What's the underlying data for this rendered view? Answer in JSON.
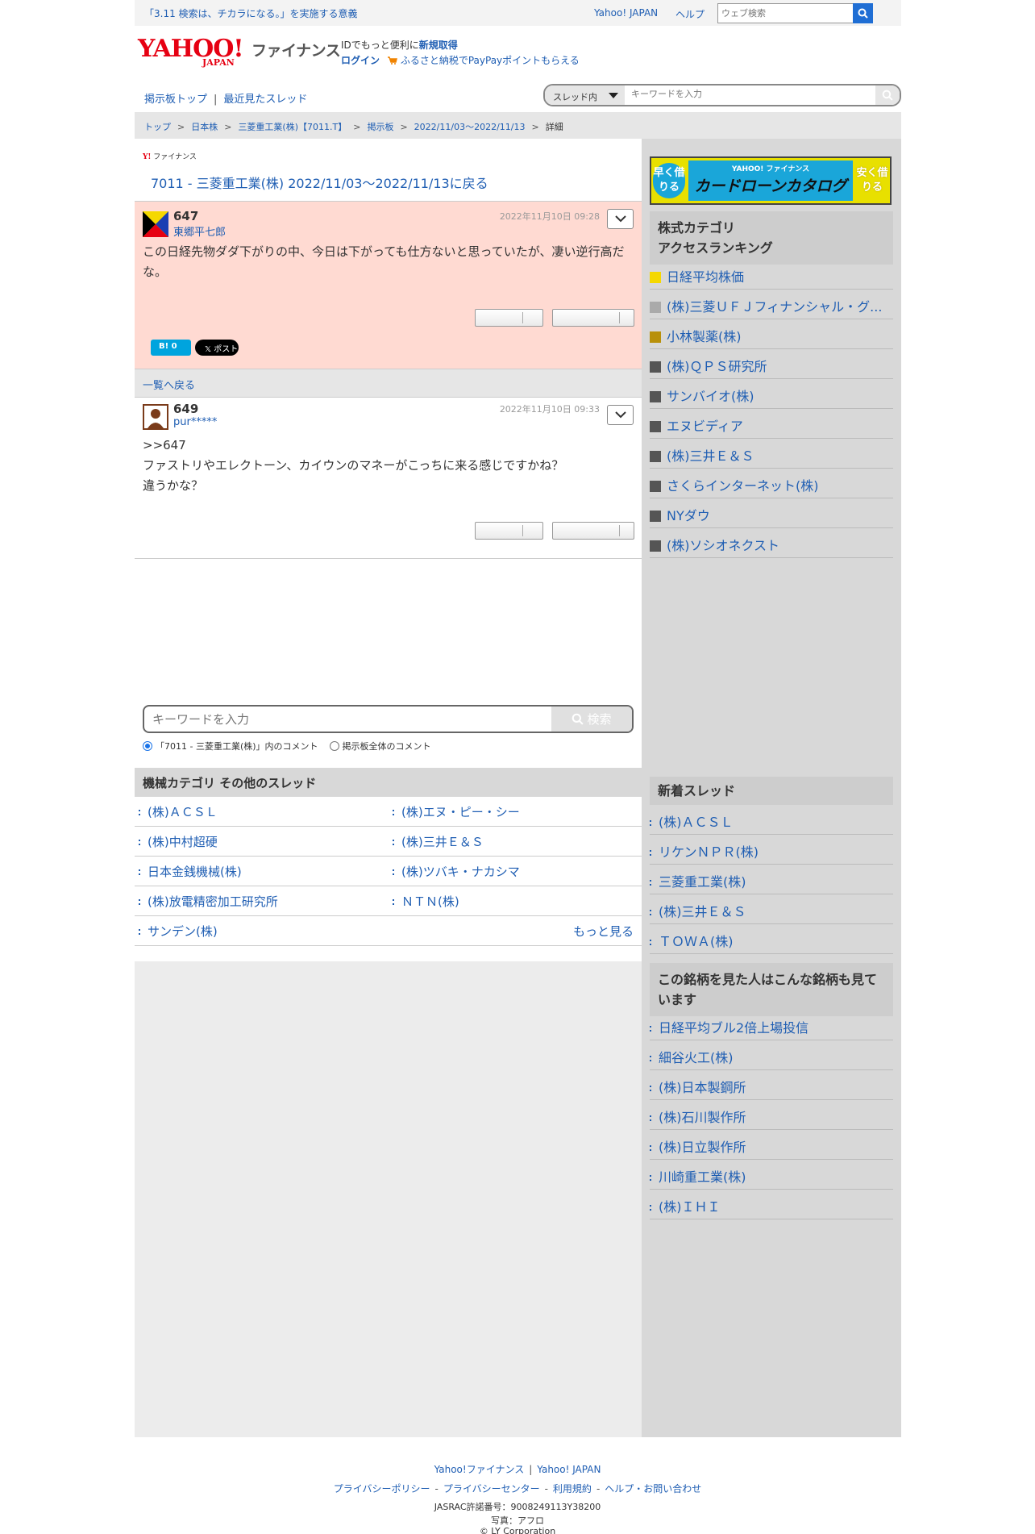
{
  "topbar": {
    "notice": "「3.11 検索は、チカラになる。」を実施する意義",
    "yahoo_japan": "Yahoo! JAPAN",
    "help": "ヘルプ",
    "web_search_placeholder": "ウェブ検索"
  },
  "header": {
    "logo_main": "YAHOO!",
    "logo_sub": "JAPAN",
    "title": "ファイナンス",
    "id_text": "IDでもっと便利に",
    "id_link": "新規取得",
    "login": "ログイン",
    "furusato": "ふるさと納税でPayPayポイントもらえる"
  },
  "nav": {
    "board_top": "掲示板トップ",
    "recent": "最近見たスレッド",
    "scope": "スレッド内",
    "search_placeholder": "キーワードを入力"
  },
  "breadcrumb": [
    "トップ",
    "日本株",
    "三菱重工業(株)【7011.T】",
    "掲示板",
    "2022/11/03〜2022/11/13",
    "詳細"
  ],
  "main": {
    "fin_logo": "ファイナンス",
    "back_link": "7011 - 三菱重工業(株) 2022/11/03〜2022/11/13に戻る",
    "posts": [
      {
        "number": "647",
        "author": "東郷平七郎",
        "date": "2022年11月10日 09:28",
        "body": "この日経先物ダダ下がりの中、今日は下がっても仕方ないと思っていたが、凄い逆行高だな。"
      },
      {
        "number": "649",
        "author": "pur*****",
        "date": "2022年11月10日 09:33",
        "body_lines": [
          ">>647",
          "ファストリやエレクトーン、カイウンのマネーがこっちに来る感じですかね？",
          "違うかな？"
        ]
      }
    ],
    "share_b": "B! 0",
    "share_x": "𝕏 ポスト",
    "list_back": "一覧へ戻る",
    "keyword_placeholder": "キーワードを入力",
    "search_button": "検索",
    "radio_thread": "「7011 - 三菱重工業(株)」内のコメント",
    "radio_all": "掲示板全体のコメント",
    "other_head": "機械カテゴリ  その他のスレッド",
    "other_threads": [
      [
        "(株)ＡＣＳＬ",
        "(株)エヌ・ピー・シー"
      ],
      [
        "(株)中村超硬",
        "(株)三井Ｅ＆Ｓ"
      ],
      [
        "日本金銭機械(株)",
        "(株)ツバキ・ナカシマ"
      ],
      [
        "(株)放電精密加工研究所",
        "ＮＴＮ(株)"
      ],
      [
        "サンデン(株)",
        ""
      ]
    ],
    "more": "もっと見る"
  },
  "side": {
    "banner": {
      "left": "早く借りる",
      "top": "YAHOO! ファイナンス",
      "main": "カードローンカタログ",
      "right": "安く借りる"
    },
    "ranking_head": [
      "株式カテゴリ",
      "アクセスランキング"
    ],
    "ranking": [
      {
        "label": "日経平均株価",
        "color": "#f5d800"
      },
      {
        "label": "(株)三菱ＵＦＪフィナンシャル・グ...",
        "color": "#aaaaaa"
      },
      {
        "label": "小林製薬(株)",
        "color": "#b8900a"
      },
      {
        "label": "(株)ＱＰＳ研究所",
        "color": "#555555"
      },
      {
        "label": "サンバイオ(株)",
        "color": "#555555"
      },
      {
        "label": "エヌビディア",
        "color": "#555555"
      },
      {
        "label": "(株)三井Ｅ＆Ｓ",
        "color": "#555555"
      },
      {
        "label": "さくらインターネット(株)",
        "color": "#555555"
      },
      {
        "label": "NYダウ",
        "color": "#555555"
      },
      {
        "label": "(株)ソシオネクスト",
        "color": "#555555"
      }
    ],
    "new_head": "新着スレッド",
    "new_threads": [
      "(株)ＡＣＳＬ",
      "リケンＮＰＲ(株)",
      "三菱重工業(株)",
      "(株)三井Ｅ＆Ｓ",
      "ＴＯＷＡ(株)"
    ],
    "also_head": [
      "この銘柄を見た人はこんな銘柄も見て",
      "います"
    ],
    "also": [
      "日経平均ブル2倍上場投信",
      "細谷火工(株)",
      "(株)日本製鋼所",
      "(株)石川製作所",
      "(株)日立製作所",
      "川崎重工業(株)",
      "(株)ＩＨＩ"
    ]
  },
  "footer": {
    "fin": "Yahoo!ファイナンス",
    "yj": "Yahoo! JAPAN",
    "privacy": "プライバシーポリシー",
    "privacy_center": "プライバシーセンター",
    "terms": "利用規約",
    "help": "ヘルプ・お問い合わせ",
    "jasrac": "JASRAC許諾番号：9008249113Y38200",
    "photo": "写真：アフロ",
    "copyright": "© LY Corporation"
  }
}
